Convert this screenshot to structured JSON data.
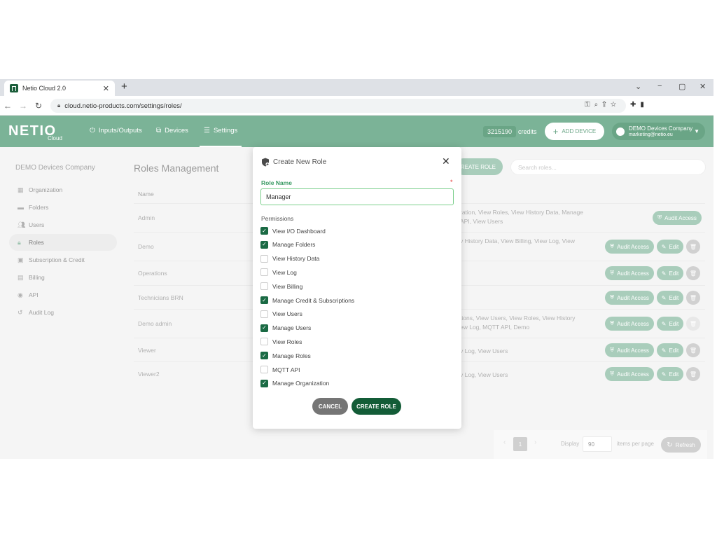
{
  "browser": {
    "tab_title": "Netio Cloud 2.0",
    "tab_close": "✕",
    "new_tab": "+",
    "url": "cloud.netio-products.com/settings/roles/",
    "win_min": "−",
    "win_max": "▢",
    "win_close": "✕",
    "win_down": "⌄"
  },
  "header": {
    "logo": "NETIO",
    "logo_sub": "Cloud",
    "nav": [
      {
        "label": "Inputs/Outputs",
        "icon": "power-icon"
      },
      {
        "label": "Devices",
        "icon": "network-icon"
      },
      {
        "label": "Settings",
        "icon": "sliders-icon"
      }
    ],
    "credits_value": "3215190",
    "credits_label": "credits",
    "add_device": "ADD DEVICE",
    "account_name": "DEMO Devices Company",
    "account_email": "marketing@netio.eu"
  },
  "sidebar": {
    "company": "DEMO Devices Company",
    "items": [
      {
        "label": "Organization",
        "icon": "building-icon"
      },
      {
        "label": "Folders",
        "icon": "folder-icon"
      },
      {
        "label": "Users",
        "icon": "users-icon"
      },
      {
        "label": "Roles",
        "icon": "lock-icon"
      },
      {
        "label": "Subscription & Credit",
        "icon": "wallet-icon"
      },
      {
        "label": "Billing",
        "icon": "billing-icon"
      },
      {
        "label": "API",
        "icon": "api-icon"
      },
      {
        "label": "Audit Log",
        "icon": "history-icon"
      }
    ]
  },
  "main": {
    "title": "Roles Management",
    "create_role": "CREATE ROLE",
    "search_placeholder": "Search roles...",
    "col_name": "Name",
    "rows": [
      {
        "name": "Admin",
        "perm1": "ration, View Roles, View History Data, Manage",
        "perm2": "API, View Users"
      },
      {
        "name": "Demo",
        "perm1": "v History Data, View Billing, View Log, View",
        "perm2": ""
      },
      {
        "name": "Operations",
        "perm1": "",
        "perm2": ""
      },
      {
        "name": "Technicians BRN",
        "perm1": "",
        "perm2": ""
      },
      {
        "name": "Demo admin",
        "perm1": "tions, View Users, View Roles, View History",
        "perm2": "ew Log, MQTT API, Demo"
      },
      {
        "name": "Viewer",
        "perm1": "v Log, View Users",
        "perm2": ""
      },
      {
        "name": "Viewer2",
        "perm1": "v Log, View Users",
        "perm2": ""
      }
    ],
    "audit_label": "Audit Access",
    "edit_label": "Edit"
  },
  "pager": {
    "prev": "‹",
    "page": "1",
    "next": "›",
    "display": "Display",
    "per_page": "90",
    "items_per_page": "items per page",
    "refresh": "Refresh"
  },
  "modal": {
    "title": "Create New Role",
    "close": "✕",
    "role_name_label": "Role Name",
    "required_mark": "*",
    "role_name_value": "Manager",
    "permissions_title": "Permissions",
    "permissions": [
      {
        "label": "View I/O Dashboard",
        "checked": true
      },
      {
        "label": "Manage Folders",
        "checked": true
      },
      {
        "label": "View History Data",
        "checked": false
      },
      {
        "label": "View Log",
        "checked": false
      },
      {
        "label": "View Billing",
        "checked": false
      },
      {
        "label": "Manage Credit & Subscriptions",
        "checked": true
      },
      {
        "label": "View Users",
        "checked": false
      },
      {
        "label": "Manage Users",
        "checked": true
      },
      {
        "label": "View Roles",
        "checked": false
      },
      {
        "label": "Manage Roles",
        "checked": true
      },
      {
        "label": "MQTT API",
        "checked": false
      },
      {
        "label": "Manage Organization",
        "checked": true
      }
    ],
    "cancel": "CANCEL",
    "create": "CREATE ROLE"
  },
  "colors": {
    "brand_green": "#7bb397",
    "dark_green": "#135c37",
    "label_green": "#3a9a63"
  }
}
